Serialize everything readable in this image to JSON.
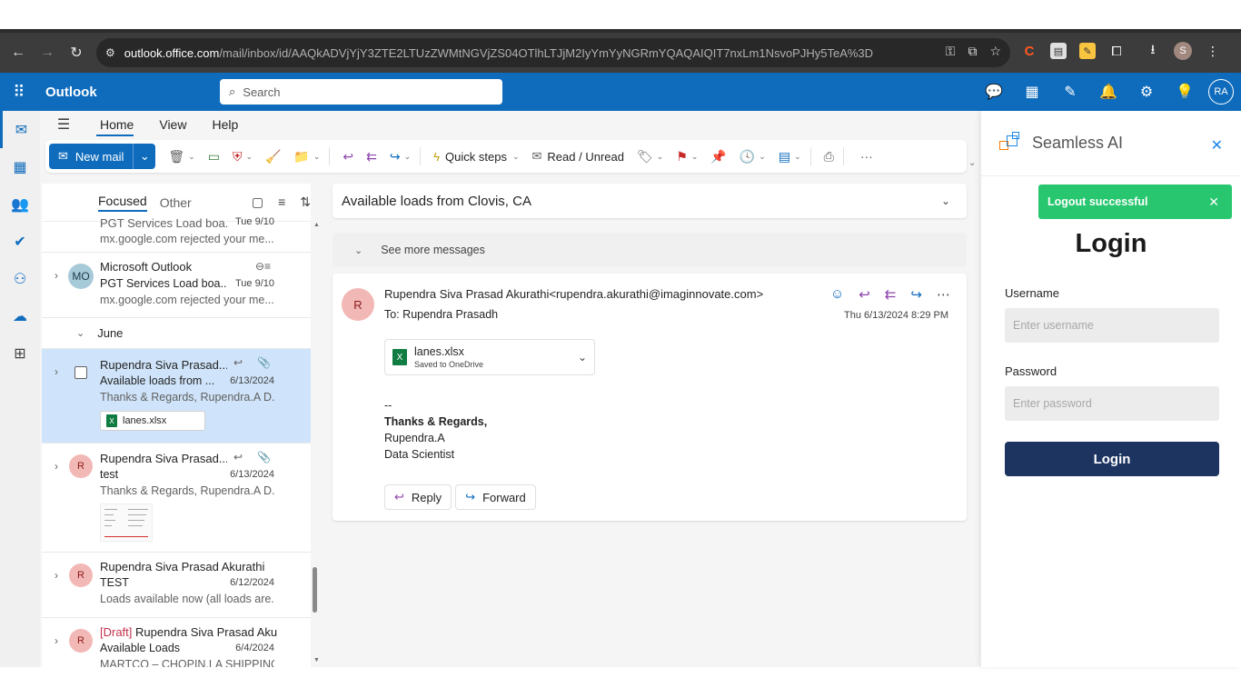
{
  "browser": {
    "url_domain": "outlook.office.com",
    "url_path": "/mail/inbox/id/AAQkADVjYjY3ZTE2LTUzZWMtNGVjZS04OTlhLTJjM2IyYmYyNGRmYQAQAIQIT7nxLm1NsvoPJHy5TeA%3D",
    "profile_initial": "S"
  },
  "header": {
    "app_title": "Outlook",
    "search_placeholder": "Search",
    "user_initials": "RA",
    "accent_color": "#0f6cbd"
  },
  "ribbon": {
    "tabs": [
      "Home",
      "View",
      "Help"
    ],
    "new_mail_label": "New mail",
    "quick_steps_label": "Quick steps",
    "read_unread_label": "Read / Unread",
    "more_label": "···"
  },
  "message_list": {
    "tabs": [
      "Focused",
      "Other"
    ],
    "messages": [
      {
        "sender": "PGT Services Load boa...",
        "date": "Tue 9/10",
        "preview": "mx.google.com rejected your me..."
      },
      {
        "avatar": "MO",
        "sender": "Microsoft Outlook",
        "subject": "PGT Services Load boa...",
        "date": "Tue 9/10",
        "preview": "mx.google.com rejected your me..."
      },
      {
        "group": "June"
      },
      {
        "avatar": "R",
        "sender": "Rupendra Siva Prasad...",
        "subject": "Available loads from ...",
        "date": "6/13/2024",
        "preview": "Thanks & Regards, Rupendra.A D...",
        "attachment": "lanes.xlsx"
      },
      {
        "avatar": "R",
        "sender": "Rupendra Siva Prasad...",
        "subject": "test",
        "date": "6/13/2024",
        "preview": "Thanks & Regards, Rupendra.A D..."
      },
      {
        "avatar": "R",
        "sender": "Rupendra Siva Prasad Akurathi",
        "subject": "TEST",
        "date": "6/12/2024",
        "preview": "Loads available now (all loads are..."
      },
      {
        "avatar": "R",
        "draft_tag": "[Draft]",
        "sender": "Rupendra Siva Prasad Aku...",
        "subject": "Available Loads",
        "date": "6/4/2024",
        "preview": "MARTCO – CHOPIN,LA SHIPPING..."
      }
    ]
  },
  "reading_pane": {
    "subject": "Available loads from Clovis, CA",
    "see_more": "See more messages",
    "avatar": "R",
    "from": "Rupendra Siva Prasad Akurathi<rupendra.akurathi@imaginnovate.com>",
    "to_label": "To:",
    "to": "Rupendra Prasadh",
    "date": "Thu 6/13/2024 8:29 PM",
    "attachment_name": "lanes.xlsx",
    "attachment_sub": "Saved to OneDrive",
    "body_sep": "--",
    "body_regards": "Thanks & Regards,",
    "body_name": "Rupendra.A",
    "body_title": "Data Scientist",
    "reply_label": "Reply",
    "forward_label": "Forward"
  },
  "seamless_panel": {
    "brand": "Seamless AI",
    "toast": "Logout successful",
    "login_title": "Login",
    "username_label": "Username",
    "username_placeholder": "Enter username",
    "password_label": "Password",
    "password_placeholder": "Enter password",
    "login_button": "Login",
    "toast_color": "#28c76f",
    "button_color": "#1d3461"
  }
}
